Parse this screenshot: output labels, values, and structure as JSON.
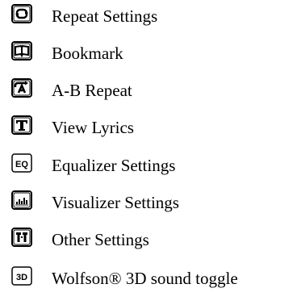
{
  "menu": {
    "items": [
      {
        "label": "Repeat Settings",
        "icon": "repeat-icon"
      },
      {
        "label": "Bookmark",
        "icon": "bookmark-icon"
      },
      {
        "label": "A-B Repeat",
        "icon": "ab-repeat-icon"
      },
      {
        "label": "View Lyrics",
        "icon": "lyrics-icon"
      },
      {
        "label": "Equalizer Settings",
        "icon": "equalizer-icon",
        "icon_text": "EQ"
      },
      {
        "label": "Visualizer Settings",
        "icon": "visualizer-icon"
      },
      {
        "label": "Other Settings",
        "icon": "other-settings-icon"
      },
      {
        "label": "Wolfson® 3D sound toggle",
        "icon": "3d-sound-icon",
        "icon_text": "3D"
      }
    ]
  }
}
